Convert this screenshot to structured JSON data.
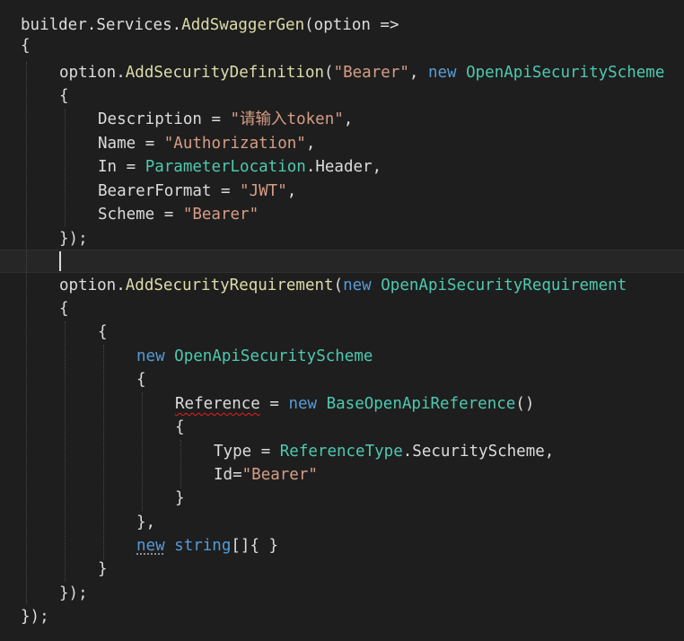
{
  "editor": {
    "lines": [
      [
        {
          "t": "builder",
          "c": "pl"
        },
        {
          "t": ".",
          "c": "pr"
        },
        {
          "t": "Services",
          "c": "pl"
        },
        {
          "t": ".",
          "c": "pr"
        },
        {
          "t": "AddSwaggerGen",
          "c": "fn"
        },
        {
          "t": "(",
          "c": "pr"
        },
        {
          "t": "option",
          "c": "pl"
        },
        {
          "t": " =>",
          "c": "pr"
        }
      ],
      [
        {
          "t": "{",
          "c": "pr"
        }
      ],
      [
        {
          "t": "option",
          "c": "pl"
        },
        {
          "t": ".",
          "c": "pr"
        },
        {
          "t": "AddSecurityDefinition",
          "c": "fn"
        },
        {
          "t": "(",
          "c": "pr"
        },
        {
          "t": "\"Bearer\"",
          "c": "st"
        },
        {
          "t": ", ",
          "c": "pr"
        },
        {
          "t": "new",
          "c": "kw"
        },
        {
          "t": " ",
          "c": "pr"
        },
        {
          "t": "OpenApiSecurityScheme",
          "c": "ty"
        }
      ],
      [
        {
          "t": "{",
          "c": "pr"
        }
      ],
      [
        {
          "t": "Description",
          "c": "pl"
        },
        {
          "t": " = ",
          "c": "pr"
        },
        {
          "t": "\"请输入token\"",
          "c": "st"
        },
        {
          "t": ",",
          "c": "pr"
        }
      ],
      [
        {
          "t": "Name",
          "c": "pl"
        },
        {
          "t": " = ",
          "c": "pr"
        },
        {
          "t": "\"Authorization\"",
          "c": "st"
        },
        {
          "t": ",",
          "c": "pr"
        }
      ],
      [
        {
          "t": "In",
          "c": "pl"
        },
        {
          "t": " = ",
          "c": "pr"
        },
        {
          "t": "ParameterLocation",
          "c": "ty"
        },
        {
          "t": ".",
          "c": "pr"
        },
        {
          "t": "Header",
          "c": "pl"
        },
        {
          "t": ",",
          "c": "pr"
        }
      ],
      [
        {
          "t": "BearerFormat",
          "c": "pl"
        },
        {
          "t": " = ",
          "c": "pr"
        },
        {
          "t": "\"JWT\"",
          "c": "st"
        },
        {
          "t": ",",
          "c": "pr"
        }
      ],
      [
        {
          "t": "Scheme",
          "c": "pl"
        },
        {
          "t": " = ",
          "c": "pr"
        },
        {
          "t": "\"Bearer\"",
          "c": "st"
        }
      ],
      [
        {
          "t": "});",
          "c": "pr"
        }
      ],
      [],
      [
        {
          "t": "option",
          "c": "pl"
        },
        {
          "t": ".",
          "c": "pr"
        },
        {
          "t": "AddSecurityRequirement",
          "c": "fn"
        },
        {
          "t": "(",
          "c": "pr"
        },
        {
          "t": "new",
          "c": "kw"
        },
        {
          "t": " ",
          "c": "pr"
        },
        {
          "t": "OpenApiSecurityRequirement",
          "c": "ty"
        }
      ],
      [
        {
          "t": "{",
          "c": "pr"
        }
      ],
      [
        {
          "t": "{",
          "c": "pr"
        }
      ],
      [
        {
          "t": "new",
          "c": "kw"
        },
        {
          "t": " ",
          "c": "pr"
        },
        {
          "t": "OpenApiSecurityScheme",
          "c": "ty"
        }
      ],
      [
        {
          "t": "{",
          "c": "pr"
        }
      ],
      [
        {
          "t": "Reference",
          "c": "pl",
          "u": "squiggle"
        },
        {
          "t": " = ",
          "c": "pr"
        },
        {
          "t": "new",
          "c": "kw"
        },
        {
          "t": " ",
          "c": "pr"
        },
        {
          "t": "BaseOpenApiReference",
          "c": "ty"
        },
        {
          "t": "()",
          "c": "pr"
        }
      ],
      [
        {
          "t": "{",
          "c": "pr"
        }
      ],
      [
        {
          "t": "Type",
          "c": "pl"
        },
        {
          "t": " = ",
          "c": "pr"
        },
        {
          "t": "ReferenceType",
          "c": "ty"
        },
        {
          "t": ".",
          "c": "pr"
        },
        {
          "t": "SecurityScheme",
          "c": "pl"
        },
        {
          "t": ",",
          "c": "pr"
        }
      ],
      [
        {
          "t": "Id",
          "c": "pl"
        },
        {
          "t": "=",
          "c": "pr"
        },
        {
          "t": "\"Bearer\"",
          "c": "st"
        }
      ],
      [
        {
          "t": "}",
          "c": "pr"
        }
      ],
      [
        {
          "t": "},",
          "c": "pr"
        }
      ],
      [
        {
          "t": "new",
          "c": "kw",
          "u": "dots"
        },
        {
          "t": " ",
          "c": "pr"
        },
        {
          "t": "string",
          "c": "kw"
        },
        {
          "t": "[]{ }",
          "c": "pr"
        }
      ],
      [
        {
          "t": "}",
          "c": "pr"
        }
      ],
      [
        {
          "t": "});",
          "c": "pr"
        }
      ],
      [
        {
          "t": "});",
          "c": "pr"
        }
      ]
    ]
  }
}
